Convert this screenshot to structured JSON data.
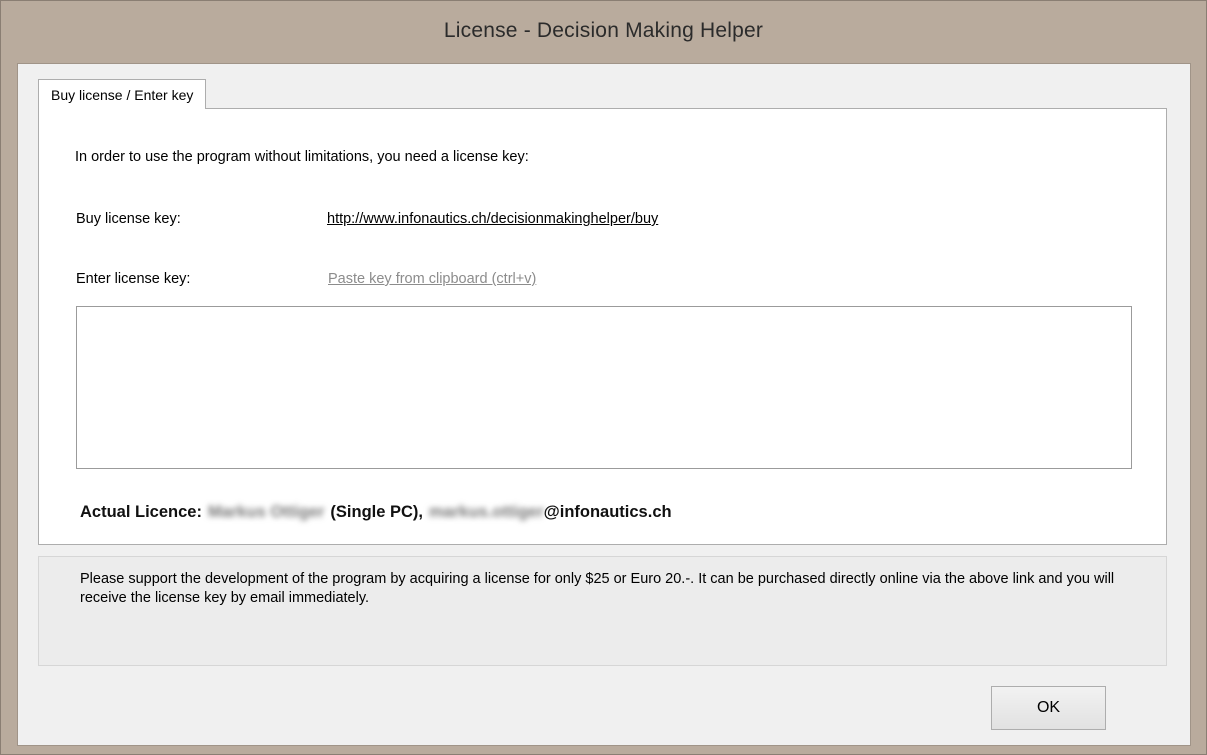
{
  "window": {
    "title": "License - Decision Making Helper"
  },
  "tab": {
    "label": "Buy license / Enter key"
  },
  "panel": {
    "intro": "In order to use the program without limitations, you need a license key:",
    "buy_label": "Buy license key:",
    "buy_link": "http://www.infonautics.ch/decisionmakinghelper/buy",
    "enter_label": "Enter license key:",
    "paste_link": "Paste key from clipboard (ctrl+v)",
    "key_value": "",
    "licence_label": "Actual Licence:",
    "licence_name_blurred": "Markus Ottiger",
    "licence_type": "(Single PC),",
    "licence_email_blurred": "markus.ottiger",
    "licence_email_domain": "@infonautics.ch"
  },
  "info": {
    "text": "Please support the development of the program by acquiring a license for only $25 or Euro 20.-. It can be purchased directly online via the above link and you will receive the license key by email immediately."
  },
  "buttons": {
    "ok_label": "OK"
  },
  "colors": {
    "frame": "#b9ab9d",
    "client": "#f0f0f0",
    "panel": "#ffffff",
    "link_grey": "#8c8c8c"
  }
}
